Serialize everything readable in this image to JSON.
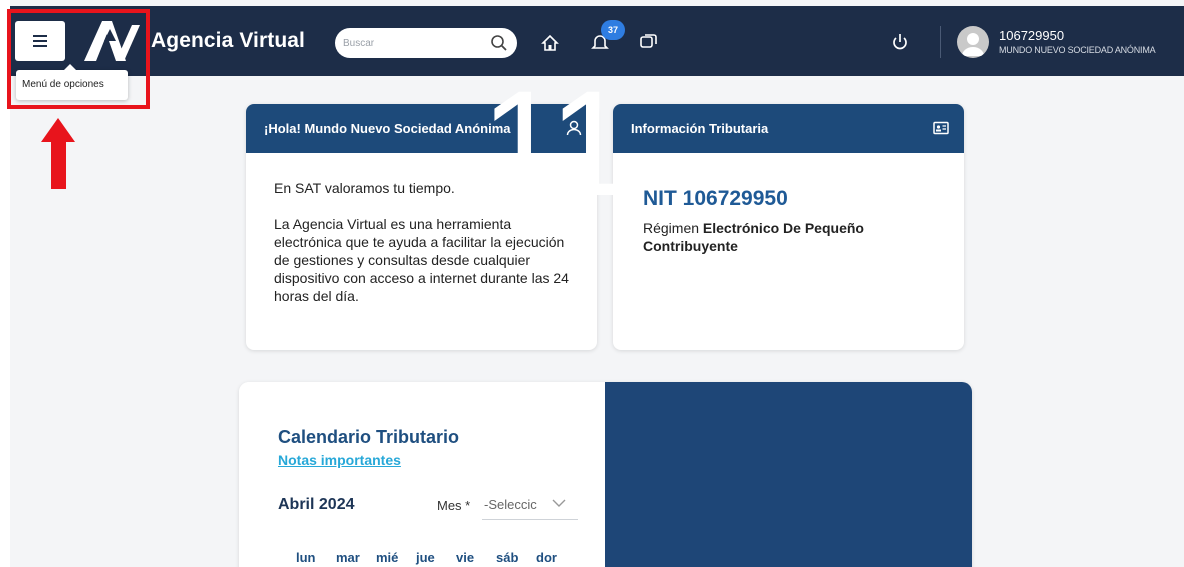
{
  "header": {
    "app_title": "Agencia Virtual",
    "search_placeholder": "Buscar",
    "notification_count": "37",
    "user_id": "106729950",
    "user_name": "MUNDO NUEVO SOCIEDAD ANÓNIMA"
  },
  "tooltip": {
    "text": "Menú de opciones"
  },
  "welcome_card": {
    "title": "¡Hola! Mundo Nuevo Sociedad Anónima",
    "paragraph1": "En SAT valoramos tu tiempo.",
    "paragraph2": "La Agencia Virtual es una herramienta electrónica que te ayuda a facilitar la ejecución de gestiones y consultas desde cualquier dispositivo con acceso a internet durante las 24 horas del día."
  },
  "tax_card": {
    "title": "Información Tributaria",
    "nit": "NIT 106729950",
    "regimen_prefix": "Régimen",
    "regimen_value": "Electrónico De Pequeño Contribuyente"
  },
  "calendar": {
    "title": "Calendario Tributario",
    "notes_link": "Notas importantes",
    "month": "Abril 2024",
    "mes_label": "Mes *",
    "mes_selected": "-Seleccic",
    "weekdays": [
      "lun",
      "mar",
      "mié",
      "jue",
      "vie",
      "sáb",
      "dor"
    ],
    "big_day": "11"
  },
  "colors": {
    "header_bg": "#1d2d48",
    "card_header": "#1d4a7a",
    "accent_red": "#e8141c",
    "link": "#27a8d8"
  }
}
